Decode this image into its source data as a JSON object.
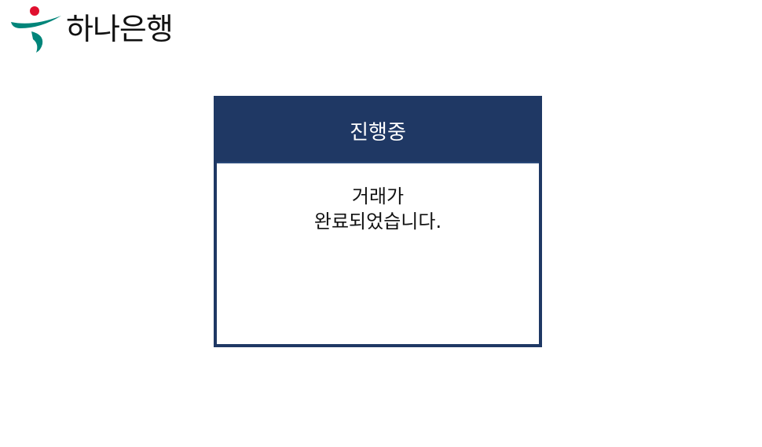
{
  "brand": {
    "name": "하나은행",
    "colors": {
      "red": "#e0102f",
      "green": "#00857a"
    }
  },
  "dialog": {
    "title": "진행중",
    "message_line1": "거래가",
    "message_line2": "완료되었습니다.",
    "header_color": "#1f3864"
  }
}
